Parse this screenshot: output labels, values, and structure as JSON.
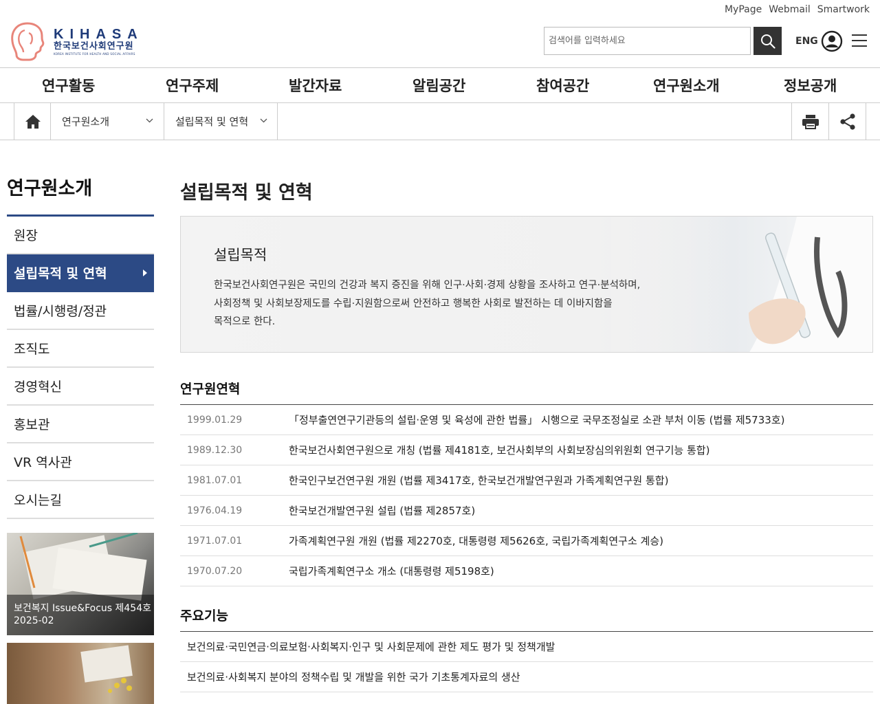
{
  "util_links": [
    "MyPage",
    "Webmail",
    "Smartwork"
  ],
  "logo": {
    "en": "KIHASA",
    "ko": "한국보건사회연구원",
    "sub": "KOREA INSTITUTE FOR HEALTH AND SOCIAL AFFAIRS"
  },
  "search": {
    "placeholder": "검색어를 입력하세요",
    "value": ""
  },
  "lang": "ENG",
  "gnb": [
    "연구활동",
    "연구주제",
    "발간자료",
    "알림공간",
    "참여공간",
    "연구원소개",
    "정보공개"
  ],
  "breadcrumb": {
    "depth1": "연구원소개",
    "depth2": "설립목적 및 연혁"
  },
  "lnb": {
    "title": "연구원소개",
    "items": [
      "원장",
      "설립목적 및 연혁",
      "법률/시행령/정관",
      "조직도",
      "경영혁신",
      "홍보관",
      "VR 역사관",
      "오시는길"
    ],
    "active_index": 1
  },
  "banners": [
    {
      "caption_line1": "보건복지 Issue&Focus 제454호",
      "caption_line2": "2025-02"
    }
  ],
  "content": {
    "title": "설립목적 및 연혁",
    "purpose": {
      "heading": "설립목적",
      "lines": [
        "한국보건사회연구원은 국민의 건강과 복지 증진을 위해 인구·사회·경제 상황을 조사하고 연구·분석하며,",
        "사회정책 및 사회보장제도를 수립·지원함으로써 안전하고 행복한 사회로 발전하는 데 이바지함을",
        "목적으로 한다."
      ]
    },
    "history_title": "연구원연혁",
    "history": [
      {
        "date": "1999.01.29",
        "text": "「정부출연연구기관등의 설립·운영 및 육성에 관한 법률」 시행으로 국무조정실로 소관 부처 이동 (법률 제5733호)"
      },
      {
        "date": "1989.12.30",
        "text": "한국보건사회연구원으로 개칭 (법률 제4181호, 보건사회부의 사회보장심의위원회 연구기능 통합)"
      },
      {
        "date": "1981.07.01",
        "text": "한국인구보건연구원 개원 (법률 제3417호, 한국보건개발연구원과 가족계획연구원 통합)"
      },
      {
        "date": "1976.04.19",
        "text": "한국보건개발연구원 설립 (법률 제2857호)"
      },
      {
        "date": "1971.07.01",
        "text": "가족계획연구원 개원 (법률 제2270호, 대통령령 제5626호, 국립가족계획연구소 계승)"
      },
      {
        "date": "1970.07.20",
        "text": "국립가족계획연구소 개소 (대통령령 제5198호)"
      }
    ],
    "functions_title": "주요기능",
    "functions": [
      "보건의료·국민연금·의료보험·사회복지·인구 및 사회문제에 관한 제도 평가 및 정책개발",
      "보건의료·사회복지 분야의 정책수립 및 개발을 위한 국가 기초통계자료의 생산"
    ]
  }
}
